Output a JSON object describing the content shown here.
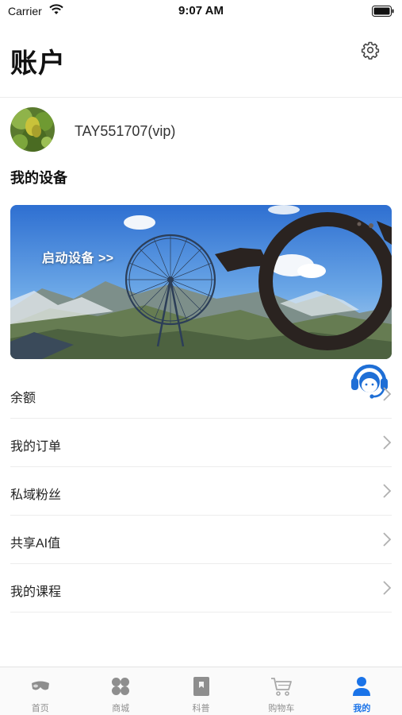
{
  "status_bar": {
    "carrier": "Carrier",
    "time": "9:07 AM"
  },
  "header": {
    "title": "账户",
    "settings_icon": "gear-icon"
  },
  "profile": {
    "username": "TAY551707(vip)",
    "avatar_icon": "plant-photo"
  },
  "devices": {
    "section_title": "我的设备",
    "banner_label": "启动设备 >>"
  },
  "support_icon": "headset-icon",
  "menu": {
    "items": [
      {
        "label": "余额"
      },
      {
        "label": "我的订单"
      },
      {
        "label": "私域粉丝"
      },
      {
        "label": "共享AI值"
      },
      {
        "label": "我的课程"
      }
    ]
  },
  "tab_bar": {
    "active_color": "#1a73e8",
    "inactive_color": "#8e8e8e",
    "tabs": [
      {
        "label": "首页",
        "icon": "home-glasses-icon"
      },
      {
        "label": "商城",
        "icon": "grid-icon"
      },
      {
        "label": "科普",
        "icon": "bookmark-icon"
      },
      {
        "label": "购物车",
        "icon": "cart-icon"
      },
      {
        "label": "我的",
        "icon": "person-icon",
        "active": true
      }
    ]
  }
}
